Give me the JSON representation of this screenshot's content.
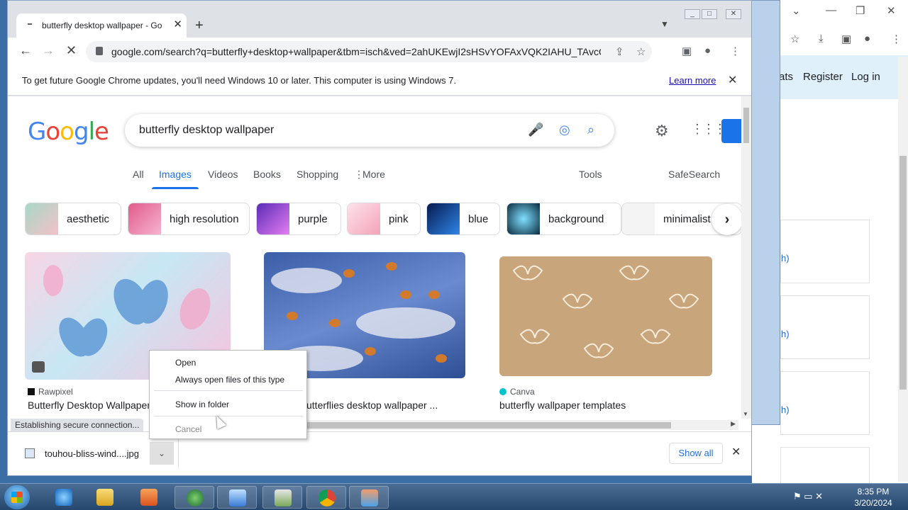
{
  "background_window": {
    "nav_partial": "ats",
    "register": "Register",
    "login": "Log in",
    "link_fragments": [
      "h)",
      "h)",
      "h)"
    ]
  },
  "tab": {
    "title": "butterfly desktop wallpaper - Go",
    "close": "✕",
    "new_tab": "+"
  },
  "omnibox": {
    "url": "google.com/search?q=butterfly+desktop+wallpaper&tbm=isch&ved=2ahUKEwjI2sHSvYOFAxVQK2IAHU_TAvcQ2-c..."
  },
  "infobar": {
    "message": "To get future Google Chrome updates, you'll need Windows 10 or later. This computer is using Windows 7.",
    "learn_more": "Learn more"
  },
  "google": {
    "logo": [
      "G",
      "o",
      "o",
      "g",
      "l",
      "e"
    ],
    "logo_colors": [
      "#4285f4",
      "#ea4335",
      "#fbbc05",
      "#4285f4",
      "#34a853",
      "#ea4335"
    ],
    "query": "butterfly desktop wallpaper",
    "tabs": [
      "All",
      "Images",
      "Videos",
      "Books",
      "Shopping",
      "More"
    ],
    "active_tab": "Images",
    "tools": "Tools",
    "safesearch": "SafeSearch"
  },
  "chips": [
    "aesthetic",
    "high resolution",
    "purple",
    "pink",
    "blue",
    "background",
    "minimalist"
  ],
  "results": [
    {
      "source": "Rawpixel",
      "title": "Butterfly Desktop Wallpaper"
    },
    {
      "source": "",
      "title": "utterflies desktop wallpaper ..."
    },
    {
      "source": "Canva",
      "title": "butterfly wallpaper templates"
    }
  ],
  "status": "Establishing secure connection...",
  "download": {
    "filename": "touhou-bliss-wind....jpg",
    "show_all": "Show all"
  },
  "context_menu": {
    "open": "Open",
    "always_open": "Always open files of this type",
    "show_in_folder": "Show in folder",
    "cancel": "Cancel"
  },
  "clock": {
    "time": "8:35 PM",
    "date": "3/20/2024"
  },
  "colors": {
    "accent": "#1a73e8",
    "link": "#1a0dab"
  }
}
